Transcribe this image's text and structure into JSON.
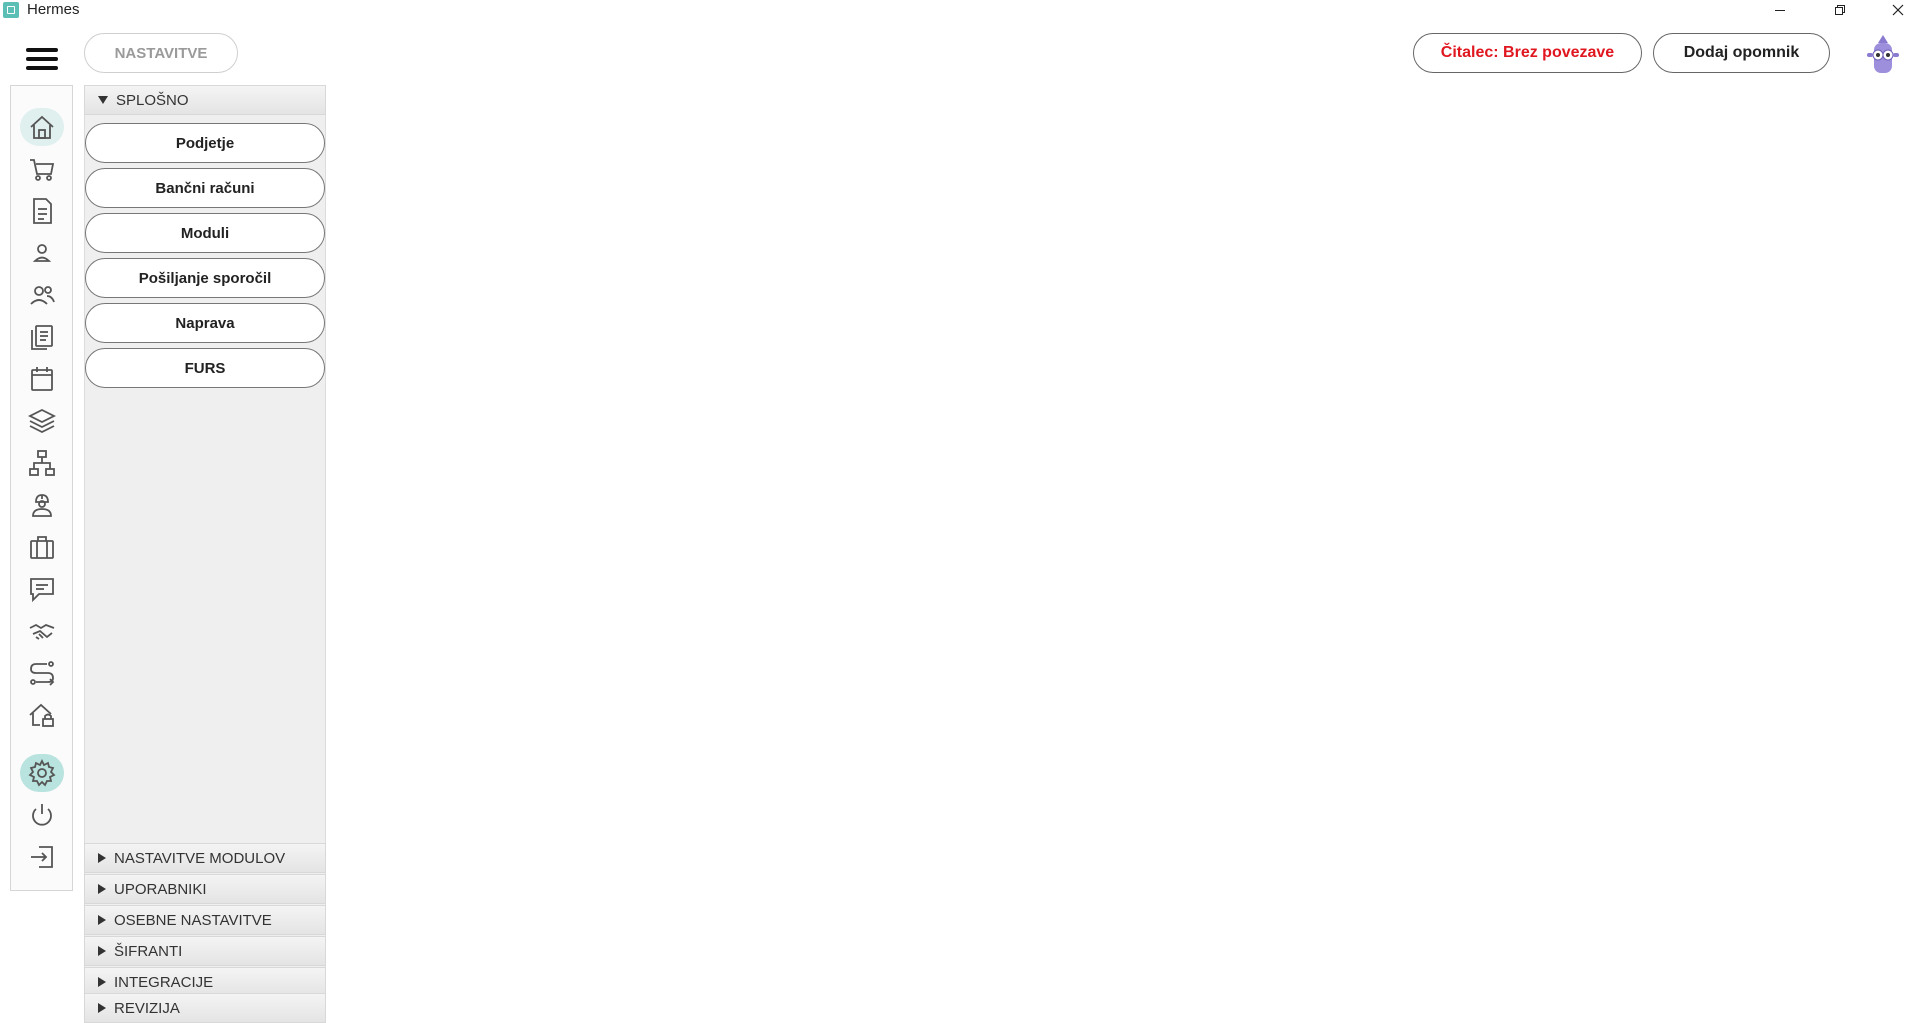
{
  "window": {
    "title": "Hermes",
    "controls": [
      "minimize-icon",
      "restore-icon",
      "close-icon"
    ]
  },
  "header": {
    "breadcrumb": "NASTAVITVE",
    "reader_status": "Čitalec: Brez povezave",
    "add_reminder": "Dodaj opomnik"
  },
  "colors": {
    "accent": "#5bbfb5",
    "active_rail": "#b9e3df",
    "reader_text": "#e0171f",
    "panel_bg": "#efefef"
  },
  "rail": {
    "items": [
      {
        "icon": "home-icon"
      },
      {
        "icon": "cart-icon"
      },
      {
        "icon": "document-icon"
      },
      {
        "icon": "user-icon"
      },
      {
        "icon": "users-icon"
      },
      {
        "icon": "copy-documents-icon"
      },
      {
        "icon": "calendar-icon"
      },
      {
        "icon": "layers-icon"
      },
      {
        "icon": "hierarchy-icon"
      },
      {
        "icon": "worker-icon"
      },
      {
        "icon": "briefcase-icon"
      },
      {
        "icon": "chat-icon"
      },
      {
        "icon": "handshake-icon"
      },
      {
        "icon": "route-icon"
      },
      {
        "icon": "house-lock-icon"
      },
      {
        "icon": "gear-icon"
      },
      {
        "icon": "power-icon"
      },
      {
        "icon": "logout-icon"
      }
    ]
  },
  "panel": {
    "open_section": "SPLOŠNO",
    "general_items": [
      "Podjetje",
      "Bančni računi",
      "Moduli",
      "Pošiljanje sporočil",
      "Naprava",
      "FURS"
    ],
    "collapsed_sections": [
      "NASTAVITVE MODULOV",
      "UPORABNIKI",
      "OSEBNE NASTAVITVE",
      "ŠIFRANTI",
      "INTEGRACIJE",
      "REVIZIJA"
    ]
  }
}
